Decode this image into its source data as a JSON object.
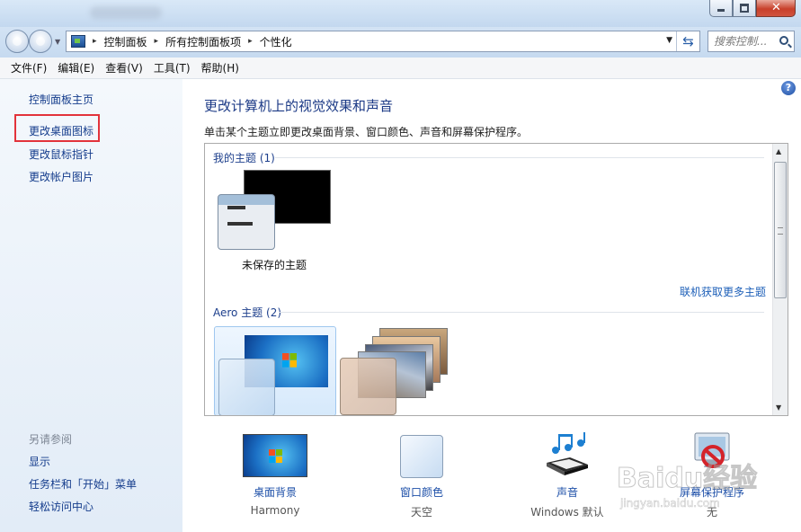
{
  "window": {
    "title": "",
    "controls": {
      "minimize": "—",
      "maximize": "□",
      "close": "✕"
    }
  },
  "address_bar": {
    "breadcrumbs": [
      "控制面板",
      "所有控制面板项",
      "个性化"
    ],
    "separator": "▸",
    "dropdown_glyph": "▼",
    "refresh_glyph": "⇆",
    "search_placeholder": "搜索控制..."
  },
  "menubar": [
    "文件(F)",
    "编辑(E)",
    "查看(V)",
    "工具(T)",
    "帮助(H)"
  ],
  "sidebar": {
    "home": "控制面板主页",
    "links": [
      "更改桌面图标",
      "更改鼠标指针",
      "更改帐户图片"
    ],
    "see_also_heading": "另请参阅",
    "see_also": [
      "显示",
      "任务栏和「开始」菜单",
      "轻松访问中心"
    ]
  },
  "main": {
    "help_glyph": "?",
    "title": "更改计算机上的视觉效果和声音",
    "description": "单击某个主题立即更改桌面背景、窗口颜色、声音和屏幕保护程序。",
    "my_themes_label": "我的主题 (1)",
    "unsaved_theme": "未保存的主题",
    "more_themes_link": "联机获取更多主题",
    "aero_label": "Aero 主题 (2)"
  },
  "settings": [
    {
      "label": "桌面背景",
      "value": "Harmony",
      "icon": "desktop-background-icon"
    },
    {
      "label": "窗口颜色",
      "value": "天空",
      "icon": "window-color-icon"
    },
    {
      "label": "声音",
      "value": "Windows 默认",
      "icon": "sound-icon"
    },
    {
      "label": "屏幕保护程序",
      "value": "无",
      "icon": "screensaver-icon"
    }
  ],
  "watermark": {
    "text": "Baidu经验",
    "url_text": "jingyan.baidu.com"
  },
  "colors": {
    "link": "#143c8c",
    "title": "#1c3a86",
    "highlight_box": "#e2333b",
    "close_button": "#c8402b"
  }
}
